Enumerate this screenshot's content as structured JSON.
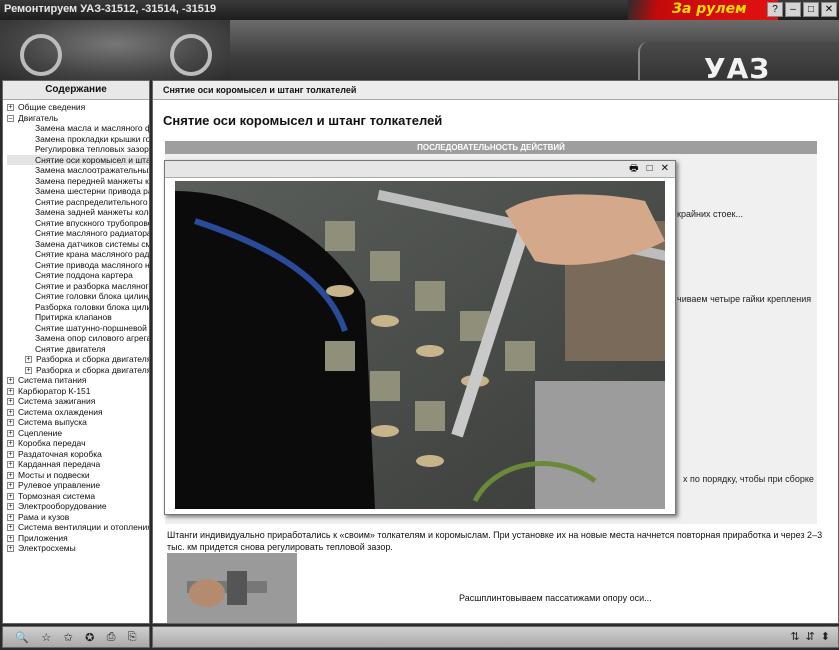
{
  "window": {
    "title": "Ремонтируем УАЗ-31512, -31514, -31519",
    "brand": "За рулем",
    "controls": [
      "?",
      "–",
      "□",
      "✕"
    ]
  },
  "header": {
    "logo": "УАЗ"
  },
  "nav": {
    "back": "◂",
    "forward": "▸",
    "home": "⌂",
    "close": "C4"
  },
  "sidebar": {
    "heading": "Содержание",
    "items": [
      {
        "label": "Общие сведения",
        "level": 0,
        "expander": "+"
      },
      {
        "label": "Двигатель",
        "level": 0,
        "expander": "–"
      },
      {
        "label": "Замена масла и масляного фильтра",
        "level": 1
      },
      {
        "label": "Замена прокладки крышки головки",
        "level": 1
      },
      {
        "label": "Регулировка тепловых зазоров в",
        "level": 1
      },
      {
        "label": "Снятие оси коромысел и штанг толкателей",
        "level": 1,
        "selected": true
      },
      {
        "label": "Замена маслоотражательных колпачков",
        "level": 1
      },
      {
        "label": "Замена передней манжеты коленвала",
        "level": 1
      },
      {
        "label": "Замена шестерни привода распредвала",
        "level": 1
      },
      {
        "label": "Снятие распределительного вала",
        "level": 1
      },
      {
        "label": "Замена задней манжеты коленвала",
        "level": 1
      },
      {
        "label": "Снятие впускного трубопровода и",
        "level": 1
      },
      {
        "label": "Снятие масляного радиатора",
        "level": 1
      },
      {
        "label": "Замена датчиков системы смазки",
        "level": 1
      },
      {
        "label": "Снятие крана масляного радиатора",
        "level": 1
      },
      {
        "label": "Снятие привода масляного насоса",
        "level": 1
      },
      {
        "label": "Снятие поддона картера",
        "level": 1
      },
      {
        "label": "Снятие и разборка масляного насоса",
        "level": 1
      },
      {
        "label": "Снятие головки блока цилиндров",
        "level": 1
      },
      {
        "label": "Разборка головки блока цилиндров",
        "level": 1
      },
      {
        "label": "Притирка клапанов",
        "level": 1
      },
      {
        "label": "Снятие шатунно-поршневой группы",
        "level": 1
      },
      {
        "label": "Замена опор силового агрегата",
        "level": 1
      },
      {
        "label": "Снятие двигателя",
        "level": 1
      },
      {
        "label": "Разборка и сборка двигателя УМЗ",
        "level": 1,
        "expander": "+"
      },
      {
        "label": "Разборка и сборка двигателя ЗМЗ",
        "level": 1,
        "expander": "+"
      },
      {
        "label": "Система питания",
        "level": 0,
        "expander": "+"
      },
      {
        "label": "Карбюратор К-151",
        "level": 0,
        "expander": "+"
      },
      {
        "label": "Система зажигания",
        "level": 0,
        "expander": "+"
      },
      {
        "label": "Система охлаждения",
        "level": 0,
        "expander": "+"
      },
      {
        "label": "Система выпуска",
        "level": 0,
        "expander": "+"
      },
      {
        "label": "Сцепление",
        "level": 0,
        "expander": "+"
      },
      {
        "label": "Коробка передач",
        "level": 0,
        "expander": "+"
      },
      {
        "label": "Раздаточная коробка",
        "level": 0,
        "expander": "+"
      },
      {
        "label": "Карданная передача",
        "level": 0,
        "expander": "+"
      },
      {
        "label": "Мосты и подвески",
        "level": 0,
        "expander": "+"
      },
      {
        "label": "Рулевое управление",
        "level": 0,
        "expander": "+"
      },
      {
        "label": "Тормозная система",
        "level": 0,
        "expander": "+"
      },
      {
        "label": "Электрооборудование",
        "level": 0,
        "expander": "+"
      },
      {
        "label": "Рама и кузов",
        "level": 0,
        "expander": "+"
      },
      {
        "label": "Система вентиляции и отопления",
        "level": 0,
        "expander": "+"
      },
      {
        "label": "Приложения",
        "level": 0,
        "expander": "+"
      },
      {
        "label": "Электросхемы",
        "level": 0,
        "expander": "+"
      }
    ]
  },
  "content": {
    "tab_title": "Снятие оси коромысел и штанг толкателей",
    "title": "Снятие оси коромысел и штанг толкателей",
    "sequence_label": "ПОСЛЕДОВАТЕЛЬНОСТЬ ДЕЙСТВИЙ",
    "frag1": "крайних стоек...",
    "frag2": "чиваем четыре гайки крепления",
    "frag3": "х по порядку, чтобы при сборке",
    "paragraph": "Штанги индивидуально приработались к «своим» толкателям и коромыслам. При установке их на новые места начнется повторная приработка и через 2–3 тыс. км придется снова регулировать тепловой зазор.",
    "caption": "Расшплинтовываем пассатижами опору оси..."
  },
  "popup": {
    "print": "🖶",
    "max": "□",
    "close": "✕"
  },
  "toolbar_left": [
    "🔍",
    "☆",
    "✩",
    "✪",
    "⎙",
    "⎘"
  ],
  "toolbar_right": [
    "⇅",
    "⇵",
    "⬍"
  ]
}
